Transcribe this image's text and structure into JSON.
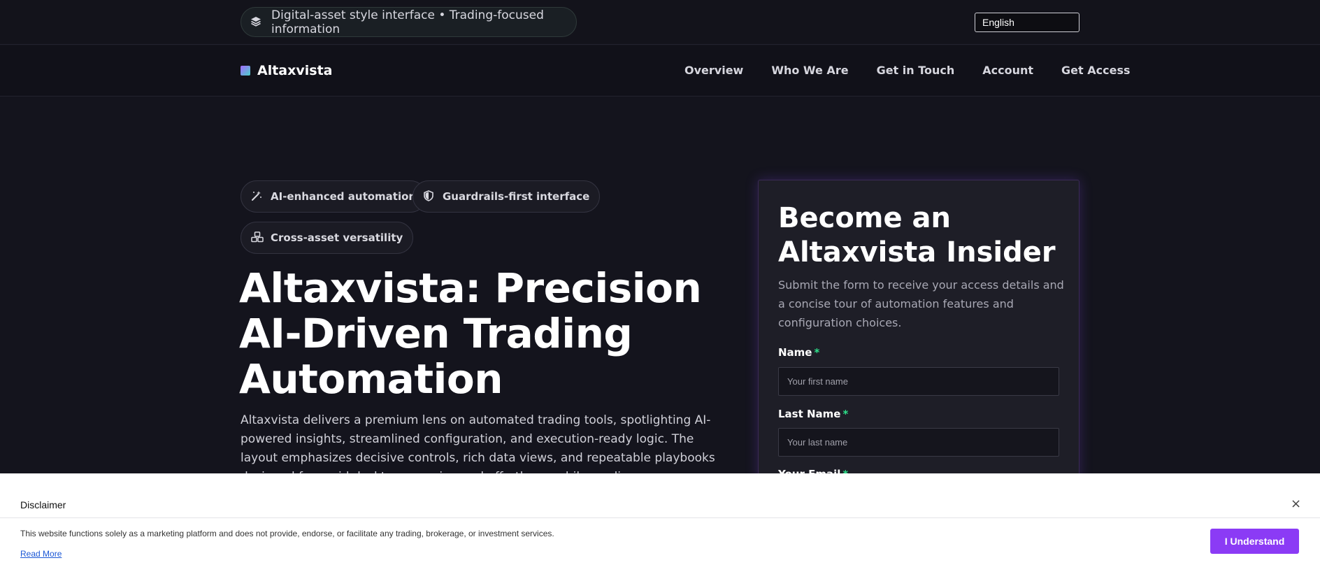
{
  "topbar": {
    "pill_text": "Digital-asset style interface • Trading-focused information",
    "pill_icon": "layers-icon",
    "language": "English"
  },
  "nav": {
    "brand": "Altaxvista",
    "items": [
      "Overview",
      "Who We Are",
      "Get in Touch",
      "Account",
      "Get Access"
    ]
  },
  "hero": {
    "chips": [
      {
        "label": "AI-enhanced automation",
        "icon": "magic-wand-icon"
      },
      {
        "label": "Guardrails-first interface",
        "icon": "shield-icon"
      },
      {
        "label": "Cross-asset versatility",
        "icon": "cubes-icon"
      }
    ],
    "headline": "Altaxvista: Precision AI-Driven Trading Automation",
    "lead": "Altaxvista delivers a premium lens on automated trading tools, spotlighting AI-powered insights, streamlined configuration, and execution-ready logic. The layout emphasizes decisive controls, rich data views, and repeatable playbooks designed for rapid desktop scanning and effortless mobile reading."
  },
  "form": {
    "title": "Become an Altaxvista Insider",
    "subtitle": "Submit the form to receive your access details and a concise tour of automation features and configuration choices.",
    "name_label": "Name",
    "name_placeholder": "Your first name",
    "last_label": "Last Name",
    "last_placeholder": "Your last name",
    "email_label": "Your Email",
    "required_mark": "*"
  },
  "disclaimer": {
    "title": "Disclaimer",
    "close": "×",
    "text": "This website functions solely as a marketing platform and does not provide, endorse, or facilitate any trading, brokerage, or investment services.",
    "read_more": "Read More",
    "accept": "I Understand"
  },
  "colors": {
    "background": "#14141d",
    "accent": "#8b3bf5",
    "required": "#2ee08a"
  }
}
